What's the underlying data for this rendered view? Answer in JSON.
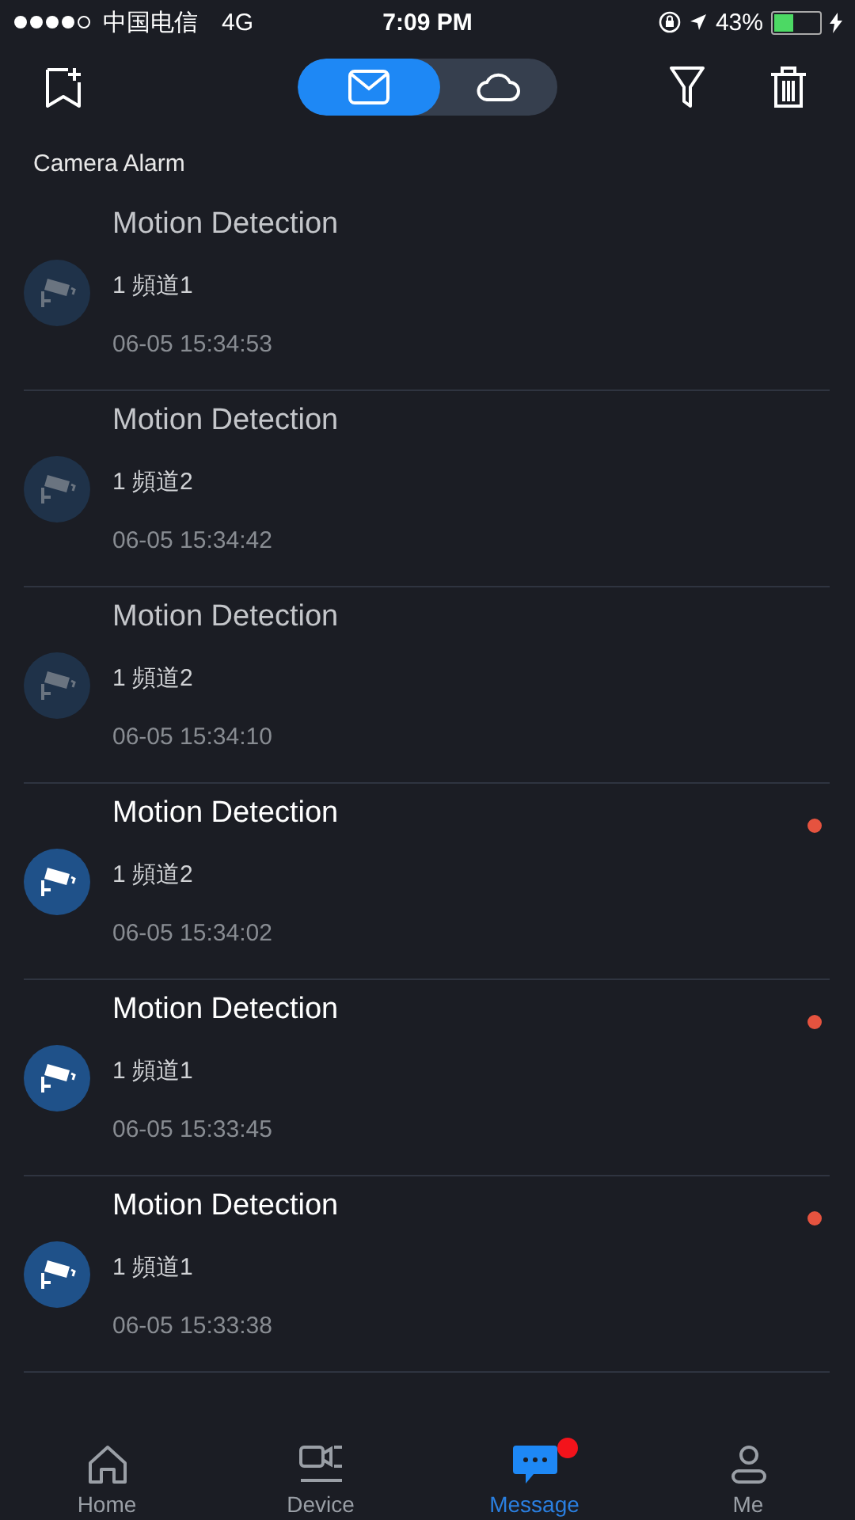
{
  "status_bar": {
    "carrier": "中国电信",
    "network": "4G",
    "time": "7:09 PM",
    "battery": "43%"
  },
  "toolbar": {
    "toggle": [
      {
        "kind": "mail",
        "selected": true
      },
      {
        "kind": "cloud",
        "selected": false
      }
    ]
  },
  "section_title": "Camera Alarm",
  "messages": [
    {
      "title": "Motion Detection",
      "channel": "1 頻道1",
      "time": "06-05 15:34:53",
      "unread": false
    },
    {
      "title": "Motion Detection",
      "channel": "1 頻道2",
      "time": "06-05 15:34:42",
      "unread": false
    },
    {
      "title": "Motion Detection",
      "channel": "1 頻道2",
      "time": "06-05 15:34:10",
      "unread": false
    },
    {
      "title": "Motion Detection",
      "channel": "1 頻道2",
      "time": "06-05 15:34:02",
      "unread": true
    },
    {
      "title": "Motion Detection",
      "channel": "1 頻道1",
      "time": "06-05 15:33:45",
      "unread": true
    },
    {
      "title": "Motion Detection",
      "channel": "1 頻道1",
      "time": "06-05 15:33:38",
      "unread": true
    }
  ],
  "tab_bar": [
    {
      "kind": "home",
      "label": "Home",
      "selected": false,
      "badge": false
    },
    {
      "kind": "device",
      "label": "Device",
      "selected": false,
      "badge": false
    },
    {
      "kind": "message",
      "label": "Message",
      "selected": true,
      "badge": true
    },
    {
      "kind": "me",
      "label": "Me",
      "selected": false,
      "badge": false
    }
  ]
}
